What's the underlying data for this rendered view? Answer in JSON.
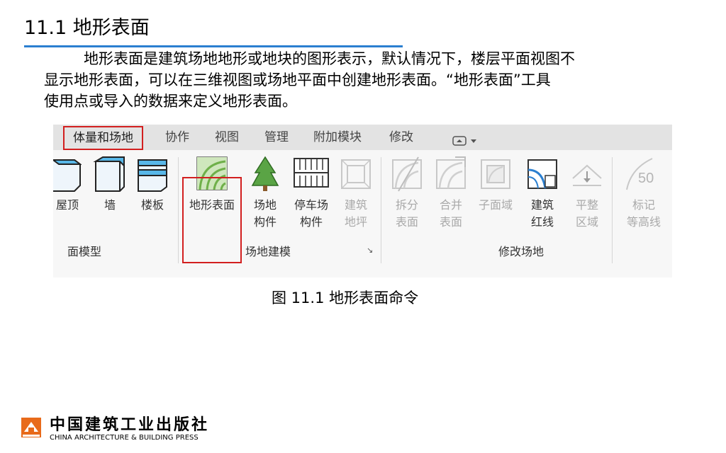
{
  "heading": "11.1  地形表面",
  "paragraph": {
    "line1": "地形表面是建筑场地地形或地块的图形表示，默认情况下，楼层平面视图不",
    "line2": "显示地形表面，可以在三维视图或场地平面中创建地形表面。“地形表面”工具",
    "line3": "使用点或导入的数据来定义地形表面。"
  },
  "ribbon": {
    "tabs": [
      "体量和场地",
      "协作",
      "视图",
      "管理",
      "附加模块",
      "修改"
    ],
    "tools": {
      "roof": "屋顶",
      "wall": "墙",
      "floor": "楼板",
      "toposurface": "地形表面",
      "site_component_1": "场地",
      "site_component_2": "构件",
      "parking_1": "停车场",
      "parking_2": "构件",
      "pad_1": "建筑",
      "pad_2": "地坪",
      "split_1": "拆分",
      "split_2": "表面",
      "merge_1": "合并",
      "merge_2": "表面",
      "subregion": "子面域",
      "property_line_1": "建筑",
      "property_line_2": "红线",
      "graded_region_1": "平整",
      "graded_region_2": "区域",
      "label_contours_1": "标记",
      "label_contours_2": "等高线",
      "label_contours_value": "50"
    },
    "groups": {
      "conceptual_mass": "面模型",
      "model_site": "场地建模",
      "modify_site": "修改场地"
    }
  },
  "caption": "图 11.1   地形表面命令",
  "publisher": {
    "name_cn": "中国建筑工业出版社",
    "name_en": "CHINA ARCHITECTURE & BUILDING PRESS"
  },
  "colors": {
    "accent_underline": "#2b7fd0",
    "highlight_red": "#d21f1f",
    "topo_green": "#6fb04a"
  }
}
